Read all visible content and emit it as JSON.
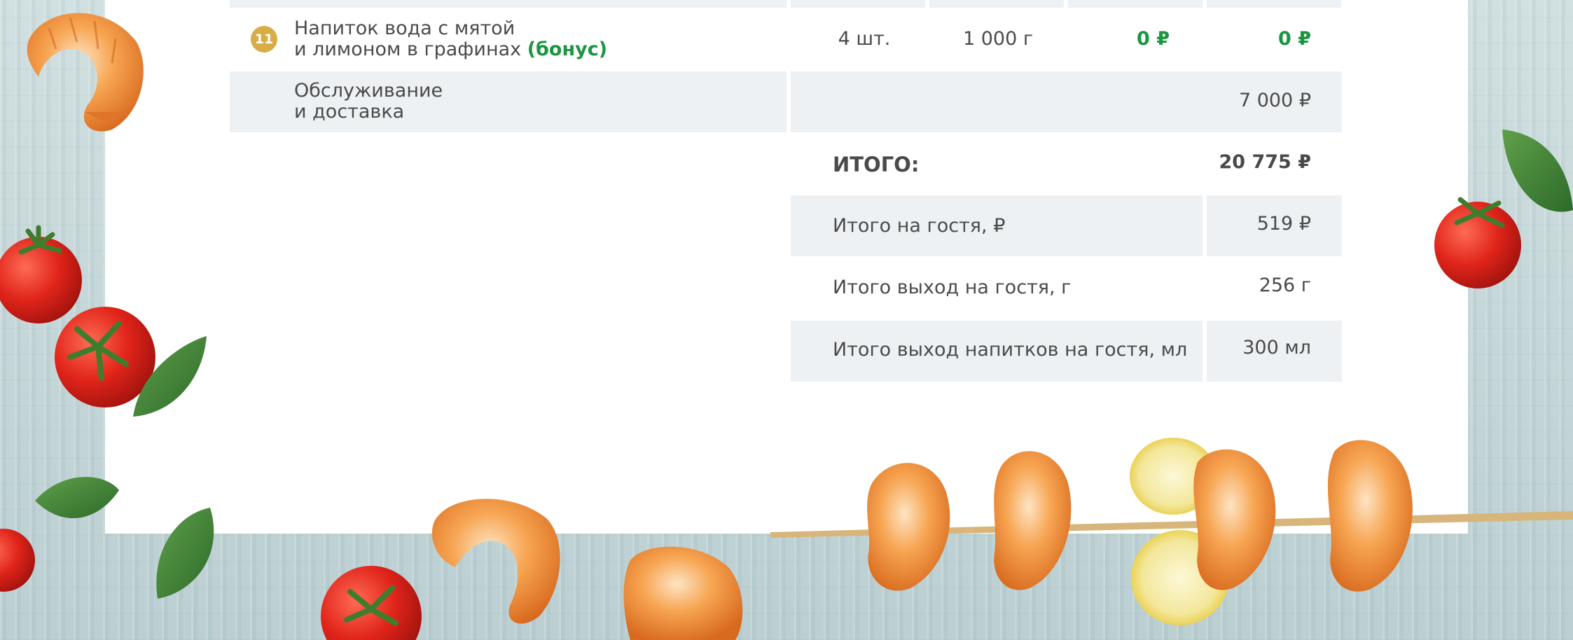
{
  "table": {
    "bonus_row": {
      "number": "11",
      "name_line1": "Напиток вода с мятой",
      "name_line2": "и лимоном в графинах",
      "bonus_tag": "(бонус)",
      "quantity": "4 шт.",
      "weight": "1 000 г",
      "price": "0 ₽",
      "total": "0 ₽"
    },
    "service_row": {
      "label_line1": "Обслуживание",
      "label_line2": "и доставка",
      "value": "7 000 ₽"
    }
  },
  "totals": {
    "grand_label": "ИТОГО:",
    "grand_value": "20 775 ₽",
    "per_guest_label": "Итого на гостя, ₽",
    "per_guest_value": "519 ₽",
    "yield_label": "Итого выход на гостя, г",
    "yield_value": "256 г",
    "drinks_label": "Итого выход напитков на гостя, мл",
    "drinks_value": "300 мл"
  },
  "colors": {
    "accent_green": "#1a9640",
    "badge_gold": "#d8ad45",
    "row_shade": "#edf1f3",
    "text": "#4a4a4a"
  }
}
